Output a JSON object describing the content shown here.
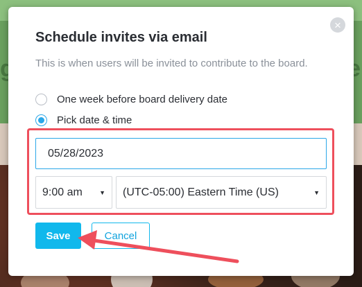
{
  "background": {
    "left_letter": "g",
    "right_letter": "e"
  },
  "modal": {
    "close_symbol": "×",
    "title": "Schedule invites via email",
    "description": "This is when users will be invited to contribute to the board.",
    "options": [
      {
        "label": "One week before board delivery date",
        "selected": false
      },
      {
        "label": "Pick date & time",
        "selected": true
      }
    ],
    "date": {
      "value": "05/28/2023"
    },
    "time": {
      "selected": "9:00 am"
    },
    "timezone": {
      "selected": "(UTC-05:00) Eastern Time (US)"
    },
    "save_label": "Save",
    "cancel_label": "Cancel"
  },
  "colors": {
    "accent": "#2aa7e8",
    "save_bg": "#11b8ec",
    "annotation": "#ee4f5c"
  },
  "icons": {
    "close": "close-icon",
    "dropdown": "caret-down-icon"
  }
}
